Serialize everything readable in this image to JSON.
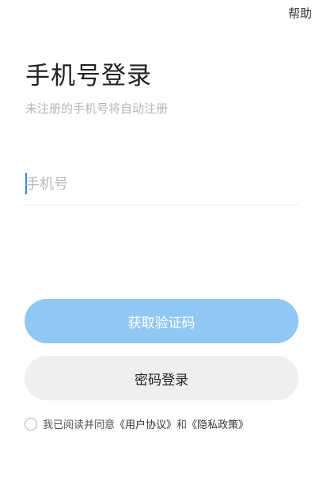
{
  "header": {
    "help_label": "帮助"
  },
  "login": {
    "title": "手机号登录",
    "subtitle": "未注册的手机号将自动注册",
    "phone_placeholder": "手机号",
    "phone_value": ""
  },
  "buttons": {
    "get_code_label": "获取验证码",
    "password_login_label": "密码登录"
  },
  "agreement": {
    "checked": false,
    "prefix": "我已阅读并同意",
    "user_agreement": "《用户协议》",
    "conjunction": "和",
    "privacy_policy": "《隐私政策》"
  },
  "colors": {
    "primary_button": "#91c8f3",
    "secondary_button": "#efefef",
    "caret": "#2d8cf0"
  }
}
